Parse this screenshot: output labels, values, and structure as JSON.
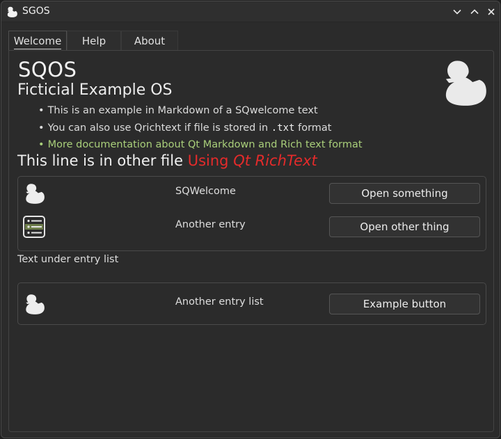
{
  "window": {
    "title": "SGOS"
  },
  "tabs": [
    {
      "label": "Welcome",
      "active": true
    },
    {
      "label": "Help",
      "active": false
    },
    {
      "label": "About",
      "active": false
    }
  ],
  "welcome": {
    "heading": "SQOS",
    "subheading": "Ficticial Example OS",
    "bullets": [
      {
        "text_before": "This is an example in Markdown of a SQwelcome text"
      },
      {
        "text_before": "You can also use Qrichtext if file is stored in ",
        "code": ".txt",
        "text_after": " format"
      },
      {
        "link_text": "More documentation about Qt Markdown and Rich text format"
      }
    ],
    "other_file_text": "This line is in other file ",
    "richtext_prefix": "Using ",
    "richtext_italic": "Qt RichText"
  },
  "entry_list_1": [
    {
      "icon": "duck-icon",
      "label": "SQWelcome",
      "button": "Open something"
    },
    {
      "icon": "list-icon",
      "label": "Another entry",
      "button": "Open other thing"
    }
  ],
  "under_list_text": "Text under entry list",
  "entry_list_2": [
    {
      "icon": "duck-icon",
      "label": "Another entry list",
      "button": "Example button"
    }
  ],
  "colors": {
    "accent_red": "#e52b2b",
    "link_green": "#a9cf7a",
    "background": "#2b2b2b"
  }
}
